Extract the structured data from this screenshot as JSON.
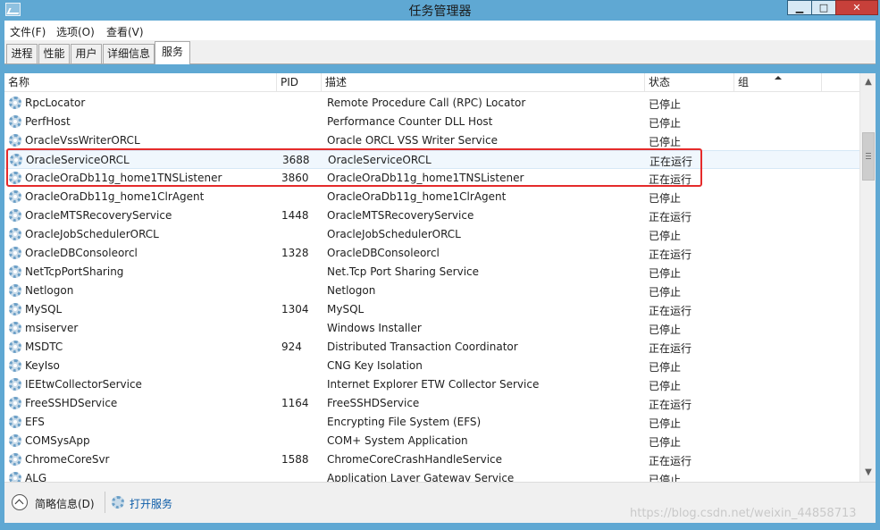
{
  "window": {
    "title": "任务管理器",
    "controls": {
      "minimize": "▁",
      "maximize": "□",
      "close": "✕"
    }
  },
  "menu": [
    "文件(F)",
    "选项(O)",
    "查看(V)"
  ],
  "tabs": [
    {
      "label": "进程",
      "active": false
    },
    {
      "label": "性能",
      "active": false
    },
    {
      "label": "用户",
      "active": false
    },
    {
      "label": "详细信息",
      "active": false
    },
    {
      "label": "服务",
      "active": true
    }
  ],
  "columns": {
    "name": "名称",
    "pid": "PID",
    "desc": "描述",
    "status": "状态",
    "group": "组"
  },
  "rows": [
    {
      "name": "RpcLocator",
      "pid": "",
      "desc": "Remote Procedure Call (RPC) Locator",
      "status": "已停止"
    },
    {
      "name": "PerfHost",
      "pid": "",
      "desc": "Performance Counter DLL Host",
      "status": "已停止"
    },
    {
      "name": "OracleVssWriterORCL",
      "pid": "",
      "desc": "Oracle ORCL VSS Writer Service",
      "status": "已停止"
    },
    {
      "name": "OracleServiceORCL",
      "pid": "3688",
      "desc": "OracleServiceORCL",
      "status": "正在运行"
    },
    {
      "name": "OracleOraDb11g_home1TNSListener",
      "pid": "3860",
      "desc": "OracleOraDb11g_home1TNSListener",
      "status": "正在运行"
    },
    {
      "name": "OracleOraDb11g_home1ClrAgent",
      "pid": "",
      "desc": "OracleOraDb11g_home1ClrAgent",
      "status": "已停止"
    },
    {
      "name": "OracleMTSRecoveryService",
      "pid": "1448",
      "desc": "OracleMTSRecoveryService",
      "status": "正在运行"
    },
    {
      "name": "OracleJobSchedulerORCL",
      "pid": "",
      "desc": "OracleJobSchedulerORCL",
      "status": "已停止"
    },
    {
      "name": "OracleDBConsoleorcl",
      "pid": "1328",
      "desc": "OracleDBConsoleorcl",
      "status": "正在运行"
    },
    {
      "name": "NetTcpPortSharing",
      "pid": "",
      "desc": "Net.Tcp Port Sharing Service",
      "status": "已停止"
    },
    {
      "name": "Netlogon",
      "pid": "",
      "desc": "Netlogon",
      "status": "已停止"
    },
    {
      "name": "MySQL",
      "pid": "1304",
      "desc": "MySQL",
      "status": "正在运行"
    },
    {
      "name": "msiserver",
      "pid": "",
      "desc": "Windows Installer",
      "status": "已停止"
    },
    {
      "name": "MSDTC",
      "pid": "924",
      "desc": "Distributed Transaction Coordinator",
      "status": "正在运行"
    },
    {
      "name": "KeyIso",
      "pid": "",
      "desc": "CNG Key Isolation",
      "status": "已停止"
    },
    {
      "name": "IEEtwCollectorService",
      "pid": "",
      "desc": "Internet Explorer ETW Collector Service",
      "status": "已停止"
    },
    {
      "name": "FreeSSHDService",
      "pid": "1164",
      "desc": "FreeSSHDService",
      "status": "正在运行"
    },
    {
      "name": "EFS",
      "pid": "",
      "desc": "Encrypting File System (EFS)",
      "status": "已停止"
    },
    {
      "name": "COMSysApp",
      "pid": "",
      "desc": "COM+ System Application",
      "status": "已停止"
    },
    {
      "name": "ChromeCoreSvr",
      "pid": "1588",
      "desc": "ChromeCoreCrashHandleService",
      "status": "正在运行"
    },
    {
      "name": "ALG",
      "pid": "",
      "desc": "Application Layer Gateway Service",
      "status": "已停止"
    }
  ],
  "footer": {
    "less_details": "简略信息(D)",
    "open_services": "打开服务",
    "watermark": "https://blog.csdn.net/weixin_44858713"
  },
  "colors": {
    "frame": "#5fa8d3",
    "highlight": "#e52b2b",
    "link": "#0c5ca8"
  }
}
